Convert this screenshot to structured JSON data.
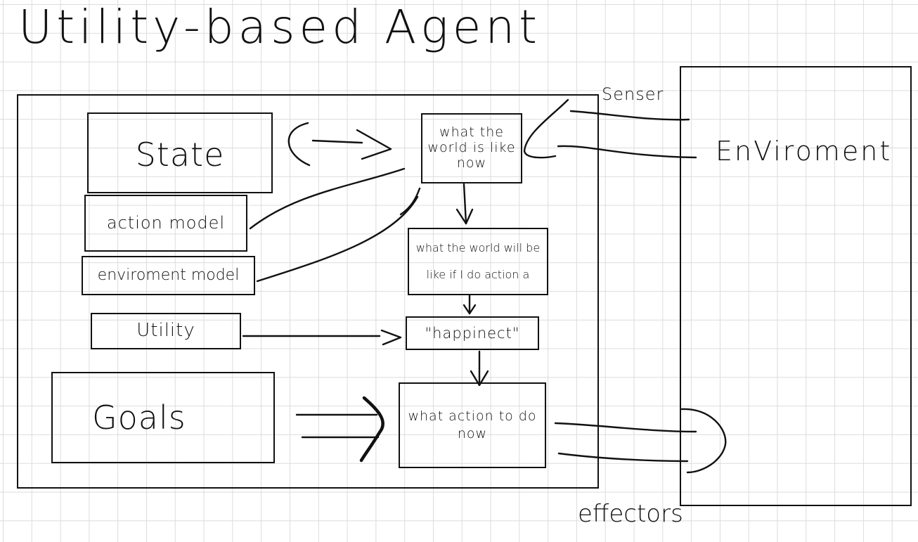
{
  "title": "Utility-based Agent",
  "agent": {
    "state": "State",
    "action_model": "action model",
    "environment_model": "enviroment model",
    "utility": "Utility",
    "goals": "Goals",
    "world_now": "what the world is like now",
    "world_will": "what the world will be like if I do action a",
    "happiness": "\"happinect\"",
    "action_now": "what action to do now"
  },
  "environment": {
    "label": "EnViroment"
  },
  "sensor_label": "Senser",
  "effectors_label": "effectors"
}
